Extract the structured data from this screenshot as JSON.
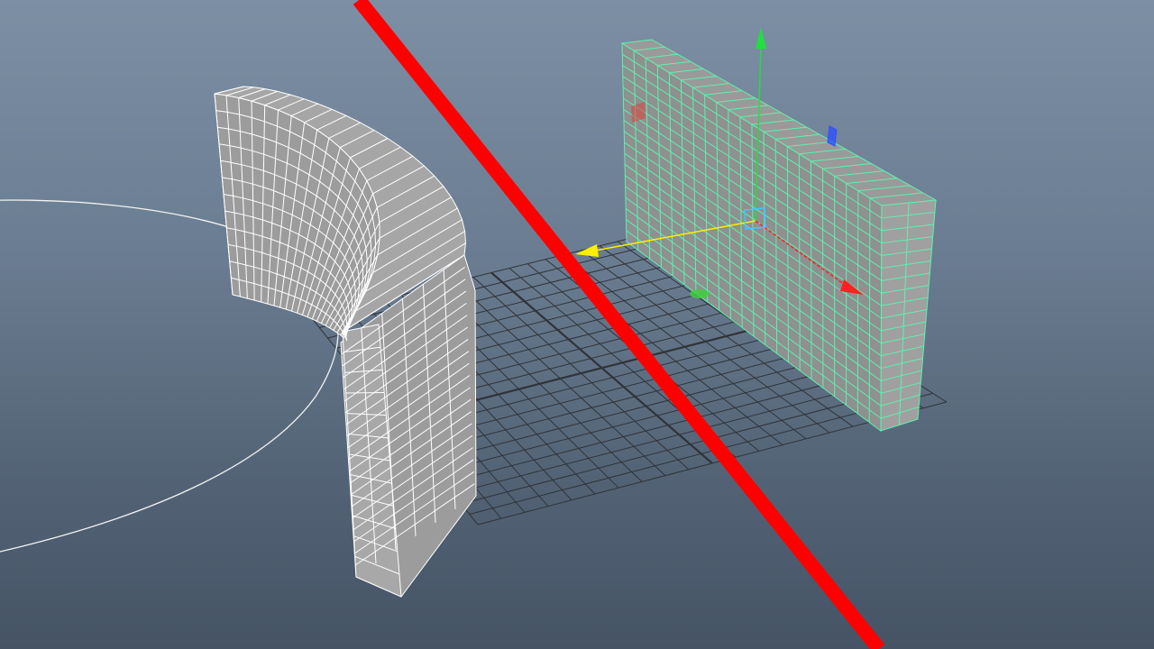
{
  "viewport": {
    "camera": "perspective",
    "background_top": "#7d8fa4",
    "background_bottom": "#455365"
  },
  "scene": {
    "ground_grid": {
      "visible": true,
      "color": "#303338"
    },
    "circle_curve": {
      "visible": true,
      "color": "#f2f2f2"
    },
    "curved_wall": {
      "kind": "polygon mesh",
      "selected": false,
      "wireframe_color": "#ffffff",
      "face_color": "#9c9c9c"
    },
    "flat_wall": {
      "kind": "polygon mesh",
      "selected": true,
      "wireframe_color": "#5ef0b0",
      "face_color": "#8f9090"
    },
    "red_line": {
      "color": "#ff0000"
    }
  },
  "manipulator": {
    "tool": "move-tool",
    "axes": [
      {
        "axis": "x",
        "color": "#ff2020"
      },
      {
        "axis": "y",
        "color": "#20e040"
      },
      {
        "axis": "z",
        "color": "#ffee00"
      }
    ],
    "plane_handle_colors": [
      "#e04040",
      "#3050ff",
      "#40d040"
    ],
    "center_color": "#40c8ff"
  }
}
